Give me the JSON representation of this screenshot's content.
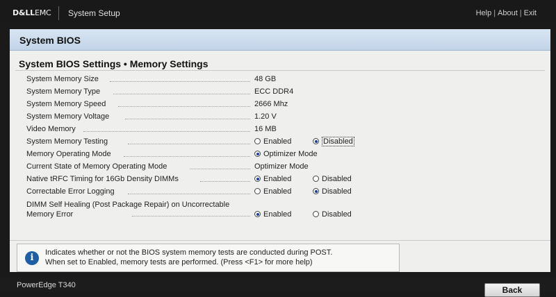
{
  "brand": {
    "dell": "D&LL",
    "emc": "EMC"
  },
  "app_title": "System Setup",
  "top_links": [
    "Help",
    "About",
    "Exit"
  ],
  "page_title": "System BIOS",
  "section_title": "System BIOS Settings • Memory Settings",
  "settings": [
    {
      "label": "System Memory Size",
      "value": "48 GB"
    },
    {
      "label": "System Memory Type",
      "value": "ECC DDR4"
    },
    {
      "label": "System Memory Speed",
      "value": "2666 Mhz"
    },
    {
      "label": "System Memory Voltage",
      "value": "1.20 V"
    },
    {
      "label": "Video Memory",
      "value": "16 MB"
    },
    {
      "label": "System Memory Testing",
      "options": [
        {
          "label": "Enabled",
          "selected": false
        },
        {
          "label": "Disabled",
          "selected": true,
          "focused": true
        }
      ]
    },
    {
      "label": "Memory Operating Mode",
      "options": [
        {
          "label": "Optimizer Mode",
          "selected": true
        }
      ]
    },
    {
      "label": "Current State of Memory Operating Mode",
      "value": "Optimizer Mode"
    },
    {
      "label": "Native tRFC Timing for 16Gb Density DIMMs",
      "options": [
        {
          "label": "Enabled",
          "selected": true
        },
        {
          "label": "Disabled",
          "selected": false
        }
      ]
    },
    {
      "label": "Correctable Error Logging",
      "options": [
        {
          "label": "Enabled",
          "selected": false
        },
        {
          "label": "Disabled",
          "selected": true
        }
      ]
    },
    {
      "label": "DIMM Self Healing (Post Package Repair) on Uncorrectable Memory Error",
      "multiline": true,
      "options": [
        {
          "label": "Enabled",
          "selected": true
        },
        {
          "label": "Disabled",
          "selected": false
        }
      ]
    }
  ],
  "help": {
    "icon": "info-icon",
    "line1": "Indicates whether or not the BIOS system memory tests are conducted during POST.",
    "line2": "When set to Enabled, memory tests are performed. (Press <F1> for more help)"
  },
  "footer": {
    "model": "PowerEdge T340",
    "back_label": "Back"
  },
  "colors": {
    "title_bar": "#c2d4e8",
    "panel": "#efefed",
    "frame": "#1a1a1a",
    "radio_selected": "#1a3f9a",
    "info_icon": "#1e5fa6"
  }
}
